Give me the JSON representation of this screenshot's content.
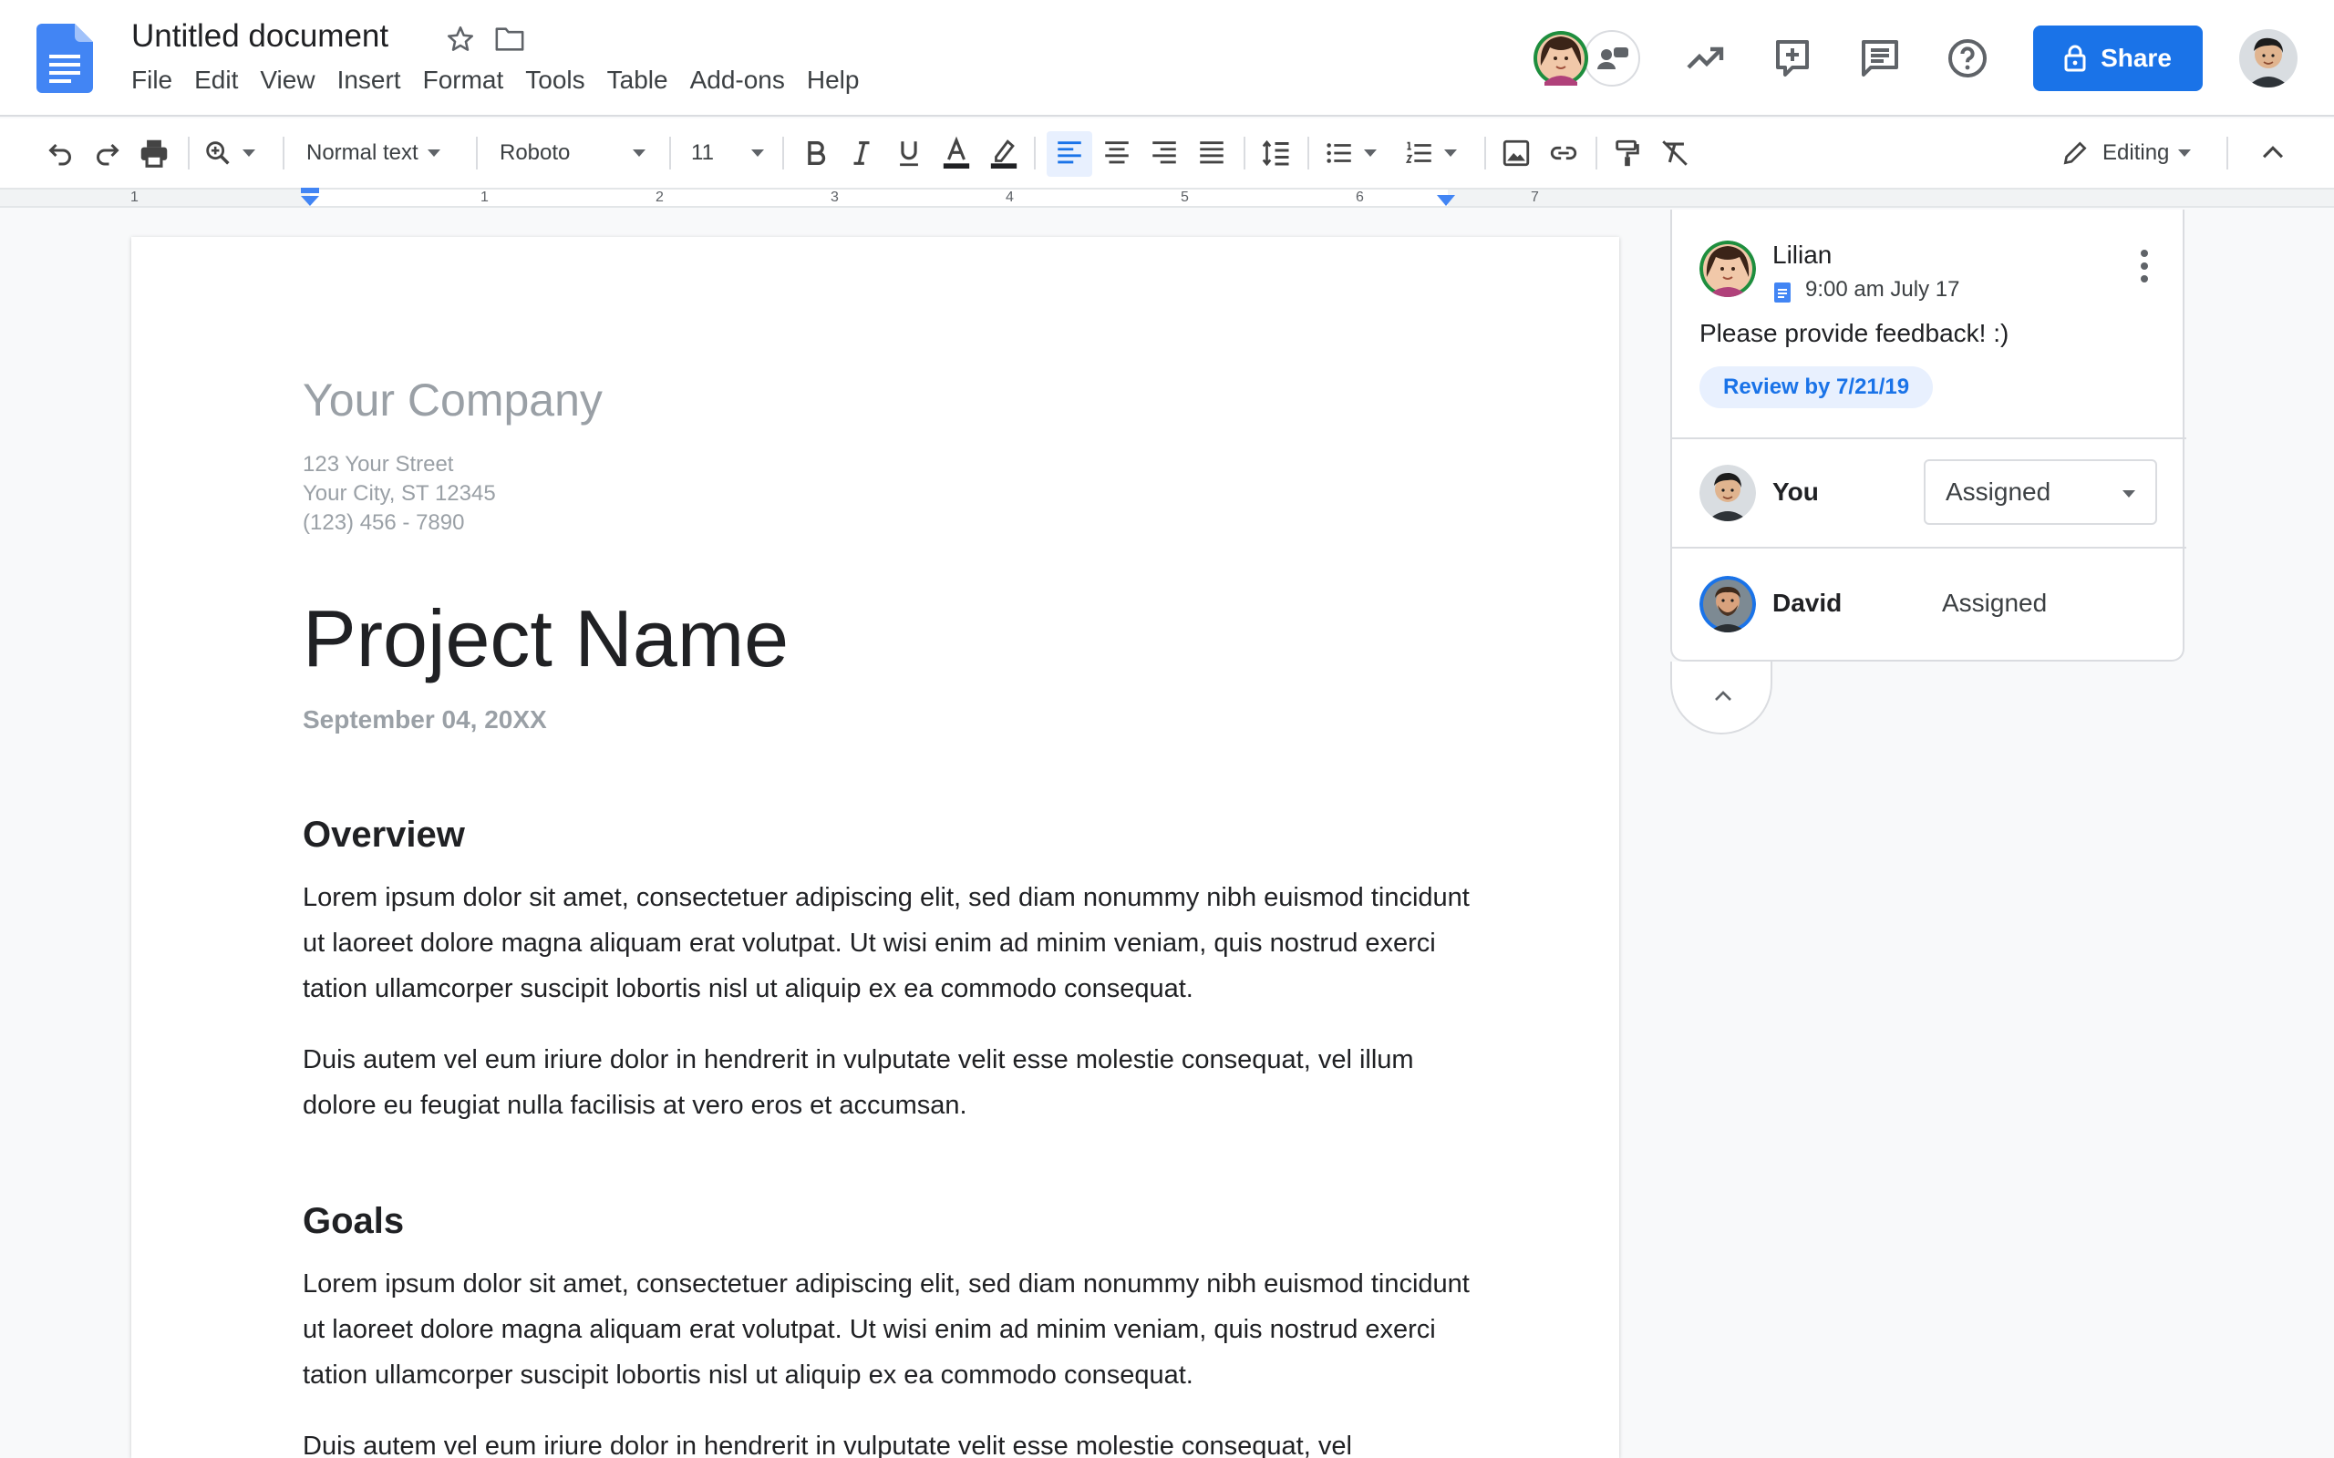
{
  "app": {
    "doc_title": "Untitled document",
    "menus": [
      "File",
      "Edit",
      "View",
      "Insert",
      "Format",
      "Tools",
      "Table",
      "Add-ons",
      "Help"
    ],
    "share_label": "Share",
    "brand_color": "#1a73e8"
  },
  "toolbar": {
    "style_label": "Normal text",
    "font_label": "Roboto",
    "size_label": "11",
    "mode_label": "Editing"
  },
  "ruler": {
    "numbers": [
      "1",
      "1",
      "2",
      "3",
      "4",
      "5",
      "6",
      "7"
    ]
  },
  "document": {
    "company": "Your Company",
    "address": [
      "123 Your Street",
      "Your City, ST 12345",
      "(123) 456 - 7890"
    ],
    "project_name": "Project Name",
    "date": "September 04, 20XX",
    "overview_heading": "Overview",
    "overview_p1": "Lorem ipsum dolor sit amet, consectetuer adipiscing elit, sed diam nonummy nibh euismod tincidunt ut laoreet dolore magna aliquam erat volutpat. Ut wisi enim ad minim veniam, quis nostrud exerci tation ullamcorper suscipit lobortis nisl ut aliquip ex ea commodo consequat.",
    "overview_p2": "Duis autem vel eum iriure dolor in hendrerit in vulputate velit esse molestie consequat, vel illum dolore eu feugiat nulla facilisis at vero eros et accumsan.",
    "goals_heading": "Goals",
    "goals_p1": "Lorem ipsum dolor sit amet, consectetuer adipiscing elit, sed diam nonummy nibh euismod tincidunt ut laoreet dolore magna aliquam erat volutpat. Ut wisi enim ad minim veniam, quis nostrud exerci tation ullamcorper suscipit lobortis nisl ut aliquip ex ea commodo consequat.",
    "goals_p2": "Duis autem vel eum iriure dolor in hendrerit in vulputate velit esse molestie consequat, vel"
  },
  "comment": {
    "author": "Lilian",
    "time": "9:00 am July 17",
    "text": "Please provide feedback! :)",
    "chip": "Review by 7/21/19",
    "assignees": [
      {
        "name": "You",
        "status": "Assigned"
      },
      {
        "name": "David",
        "status": "Assigned"
      }
    ]
  }
}
